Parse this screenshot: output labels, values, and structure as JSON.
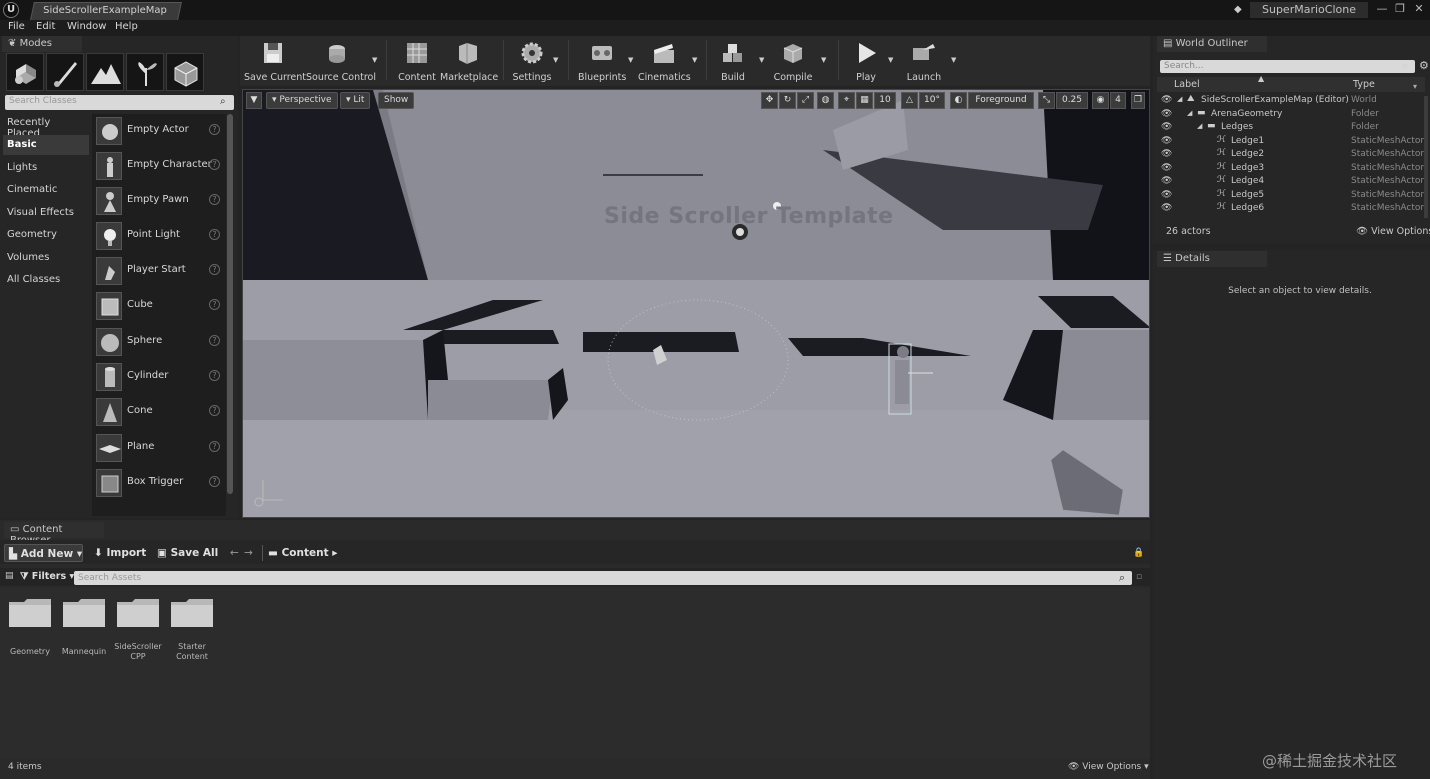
{
  "title_bar": {
    "logo": "U",
    "map_tab": "SideScrollerExampleMap",
    "project_name": "SuperMarioClone",
    "window_controls": [
      "—",
      "❐",
      "✕"
    ]
  },
  "menu": [
    "File",
    "Edit",
    "Window",
    "Help"
  ],
  "modes": {
    "tab_label": "Modes",
    "mode_icons": [
      "place-mode-icon",
      "paint-mode-icon",
      "landscape-mode-icon",
      "foliage-mode-icon",
      "geometry-mode-icon"
    ],
    "search_placeholder": "Search Classes",
    "categories": [
      "Recently Placed",
      "Basic",
      "Lights",
      "Cinematic",
      "Visual Effects",
      "Geometry",
      "Volumes",
      "All Classes"
    ],
    "active_category": "Basic",
    "classes": [
      "Empty Actor",
      "Empty Character",
      "Empty Pawn",
      "Point Light",
      "Player Start",
      "Cube",
      "Sphere",
      "Cylinder",
      "Cone",
      "Plane",
      "Box Trigger"
    ]
  },
  "toolbar": {
    "buttons": [
      "Save Current",
      "Source Control",
      "Content",
      "Marketplace",
      "Settings",
      "Blueprints",
      "Cinematics",
      "Build",
      "Compile",
      "Play",
      "Launch"
    ]
  },
  "viewport": {
    "perspective": "Perspective",
    "lit": "Lit",
    "show": "Show",
    "grid_snap": "10",
    "rotation_snap": "10°",
    "camera_layer": "Foreground",
    "scale_snap": "0.25",
    "camera_speed": "4",
    "scene_text": "Side Scroller Template"
  },
  "world_outliner": {
    "tab_label": "World Outliner",
    "search_placeholder": "Search...",
    "columns": [
      "Label",
      "Type"
    ],
    "rows": [
      {
        "label": "SideScrollerExampleMap (Editor)",
        "type": "World",
        "indent": 0
      },
      {
        "label": "ArenaGeometry",
        "type": "Folder",
        "indent": 1
      },
      {
        "label": "Ledges",
        "type": "Folder",
        "indent": 2
      },
      {
        "label": "Ledge1",
        "type": "StaticMeshActor",
        "indent": 3
      },
      {
        "label": "Ledge2",
        "type": "StaticMeshActor",
        "indent": 3
      },
      {
        "label": "Ledge3",
        "type": "StaticMeshActor",
        "indent": 3
      },
      {
        "label": "Ledge4",
        "type": "StaticMeshActor",
        "indent": 3
      },
      {
        "label": "Ledge5",
        "type": "StaticMeshActor",
        "indent": 3
      },
      {
        "label": "Ledge6",
        "type": "StaticMeshActor",
        "indent": 3
      }
    ],
    "actor_count": "26 actors",
    "view_options": "View Options"
  },
  "details": {
    "tab_label": "Details",
    "empty_message": "Select an object to view details."
  },
  "content_browser": {
    "tab_label": "Content Browser",
    "add_new": "Add New",
    "import": "Import",
    "save_all": "Save All",
    "path": "Content",
    "filters": "Filters",
    "search_placeholder": "Search Assets",
    "folders": [
      "Geometry",
      "Mannequin",
      "SideScroller CPP",
      "Starter Content"
    ],
    "items_count": "4 items",
    "view_options": "View Options"
  },
  "watermark": "@稀土掘金技术社区"
}
